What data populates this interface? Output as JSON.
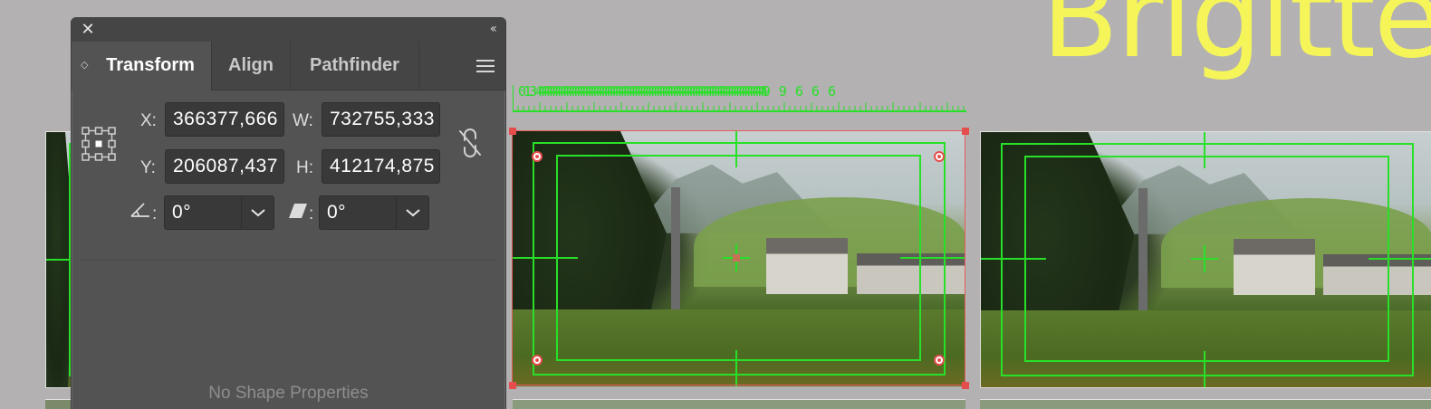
{
  "artboard": {
    "title_fragment": "Brigitte"
  },
  "ruler": {
    "label_start": "0 1 3 4",
    "label_end": "9 9 6 6 6"
  },
  "transform_panel": {
    "close_symbol": "✕",
    "collapse_symbol": "‹‹",
    "tabs": [
      {
        "label": "Transform",
        "active": true
      },
      {
        "label": "Align",
        "active": false
      },
      {
        "label": "Pathfinder",
        "active": false
      }
    ],
    "reference_point_icon": "reference-point-grid-icon",
    "fields": {
      "x_label": "X:",
      "x_value": "366377,666",
      "y_label": "Y:",
      "y_value": "206087,437",
      "w_label": "W:",
      "w_value": "732755,333",
      "h_label": "H:",
      "h_value": "412174,875",
      "rotate_label": ":",
      "rotate_value": "0°",
      "shear_label": ":",
      "shear_value": "0°"
    },
    "constrain_icon": "unlinked-chain-icon",
    "empty_state": "No Shape Properties"
  },
  "colors": {
    "canvas": "#b3b1b2",
    "guide_green": "#27e027",
    "selection_red": "#e65c5c",
    "title_yellow": "#f5f55a",
    "panel_bg": "#535353"
  }
}
